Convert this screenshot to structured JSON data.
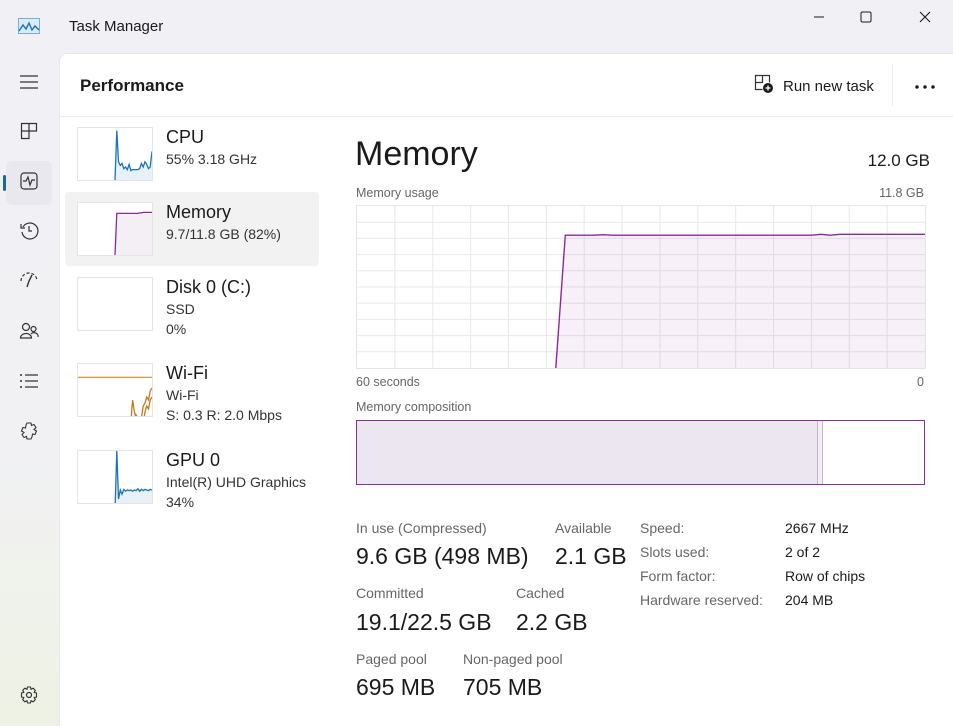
{
  "window": {
    "title": "Task Manager",
    "app_icon": "task-manager-icon",
    "controls": {
      "minimize": "minimize-icon",
      "maximize": "maximize-icon",
      "close": "close-icon"
    }
  },
  "nav": {
    "items": [
      {
        "icon": "hamburger-menu-icon",
        "label": "Menu",
        "active": false
      },
      {
        "icon": "processes-icon",
        "label": "Processes",
        "active": false
      },
      {
        "icon": "performance-icon",
        "label": "Performance",
        "active": true
      },
      {
        "icon": "app-history-icon",
        "label": "App history",
        "active": false
      },
      {
        "icon": "startup-apps-icon",
        "label": "Startup apps",
        "active": false
      },
      {
        "icon": "users-icon",
        "label": "Users",
        "active": false
      },
      {
        "icon": "details-icon",
        "label": "Details",
        "active": false
      },
      {
        "icon": "services-icon",
        "label": "Services",
        "active": false
      }
    ],
    "settings": {
      "icon": "settings-icon",
      "label": "Settings"
    }
  },
  "header": {
    "title": "Performance",
    "run_new_task": "Run new task",
    "more": "more-options-icon"
  },
  "colors": {
    "cpu": "#1a73b5",
    "memory": "#8b2a9a",
    "wifi": "#c27a1c",
    "gpu": "#1a73b5",
    "accent": "#1f6a8a"
  },
  "resources": [
    {
      "name": "CPU",
      "sub1": "55%  3.18 GHz",
      "sub2": "",
      "active": false
    },
    {
      "name": "Memory",
      "sub1": "9.7/11.8 GB (82%)",
      "sub2": "",
      "active": true
    },
    {
      "name": "Disk 0 (C:)",
      "sub1": "SSD",
      "sub2": "0%",
      "active": false
    },
    {
      "name": "Wi-Fi",
      "sub1": "Wi-Fi",
      "sub2": "S: 0.3 R: 2.0 Mbps",
      "active": false
    },
    {
      "name": "GPU 0",
      "sub1": "Intel(R) UHD Graphics",
      "sub2": "34%",
      "active": false
    }
  ],
  "memory": {
    "title": "Memory",
    "total": "12.0 GB",
    "usage_label": "Memory usage",
    "usage_max": "11.8 GB",
    "axis_left": "60 seconds",
    "axis_right": "0",
    "usage_series_fraction": [
      0,
      0,
      0,
      0,
      0,
      0,
      0,
      0,
      0,
      0,
      0,
      0,
      0,
      0,
      0,
      0,
      0,
      0,
      0,
      0,
      0,
      0,
      0.82,
      0.82,
      0.82,
      0.82,
      0.823,
      0.82,
      0.82,
      0.82,
      0.82,
      0.82,
      0.82,
      0.82,
      0.82,
      0.82,
      0.82,
      0.82,
      0.82,
      0.82,
      0.82,
      0.82,
      0.82,
      0.82,
      0.82,
      0.82,
      0.82,
      0.82,
      0.82,
      0.825,
      0.82,
      0.825,
      0.825,
      0.825,
      0.825,
      0.825,
      0.825,
      0.825,
      0.825,
      0.825,
      0.825
    ],
    "composition_label": "Memory composition",
    "composition": {
      "in_use_fraction": 0.815,
      "modified_fraction": 0.008
    },
    "stats": {
      "in_use_label": "In use (Compressed)",
      "in_use_value": "9.6 GB (498 MB)",
      "available_label": "Available",
      "available_value": "2.1 GB",
      "committed_label": "Committed",
      "committed_value": "19.1/22.5 GB",
      "cached_label": "Cached",
      "cached_value": "2.2 GB",
      "paged_label": "Paged pool",
      "paged_value": "695 MB",
      "nonpaged_label": "Non-paged pool",
      "nonpaged_value": "705 MB"
    },
    "specs": [
      {
        "label": "Speed:",
        "value": "2667 MHz"
      },
      {
        "label": "Slots used:",
        "value": "2 of 2"
      },
      {
        "label": "Form factor:",
        "value": "Row of chips"
      },
      {
        "label": "Hardware reserved:",
        "value": "204 MB"
      }
    ]
  },
  "sparklines": {
    "cpu": [
      0,
      0,
      0,
      0,
      0,
      0,
      0,
      0,
      0,
      0,
      0,
      0,
      0,
      0,
      0,
      0,
      0,
      0,
      0,
      0,
      0,
      0,
      0.95,
      0.35,
      0.28,
      0.32,
      0.22,
      0.25,
      0.2,
      0.3,
      0.18,
      0.2,
      0.2,
      0.2,
      0.2,
      0.22,
      0.32,
      0.25,
      0.35,
      0.3,
      0.22,
      0.25,
      0.55
    ],
    "memory": [
      0,
      0,
      0,
      0,
      0,
      0,
      0,
      0,
      0,
      0,
      0,
      0,
      0,
      0,
      0,
      0,
      0,
      0,
      0,
      0,
      0,
      0,
      0.8,
      0.8,
      0.8,
      0.8,
      0.8,
      0.8,
      0.8,
      0.8,
      0.8,
      0.8,
      0.8,
      0.8,
      0.8,
      0.81,
      0.81,
      0.82,
      0.82,
      0.82,
      0.82,
      0.82,
      0.82
    ],
    "disk": [
      0,
      0,
      0,
      0,
      0,
      0,
      0,
      0,
      0,
      0,
      0,
      0,
      0,
      0,
      0,
      0,
      0,
      0,
      0,
      0,
      0,
      0,
      0,
      0,
      0,
      0,
      0,
      0,
      0,
      0.02,
      0,
      0,
      0,
      0,
      0,
      0.03,
      0.06,
      0.02,
      0,
      0,
      0,
      0,
      0
    ],
    "wifi_send": [
      0,
      0,
      0,
      0,
      0,
      0,
      0,
      0,
      0,
      0,
      0,
      0,
      0,
      0,
      0,
      0,
      0,
      0,
      0,
      0,
      0,
      0,
      0.02,
      0.02,
      0.02,
      0.02,
      0.02,
      0.02,
      0.03,
      0.02,
      0.05,
      0.4,
      0.2,
      0.1,
      0.08,
      0.05,
      0.1,
      0.3,
      0.35,
      0.45,
      0.4,
      0.55,
      0.6
    ],
    "wifi_recv": [
      0,
      0,
      0,
      0,
      0,
      0,
      0,
      0,
      0,
      0,
      0,
      0,
      0,
      0,
      0,
      0,
      0,
      0,
      0,
      0,
      0,
      0,
      0.01,
      0.01,
      0.01,
      0.01,
      0.01,
      0.01,
      0.01,
      0.01,
      0.02,
      0.1,
      0.05,
      0.15,
      0.1,
      0.08,
      0.05,
      0.02,
      0.2,
      0.3,
      0.25,
      0.4,
      0.45
    ],
    "wifi_max_line": 0.78,
    "gpu": [
      0,
      0,
      0,
      0,
      0,
      0,
      0,
      0,
      0,
      0,
      0,
      0,
      0,
      0,
      0,
      0,
      0,
      0,
      0,
      0,
      0,
      0,
      1.0,
      0.2,
      0.35,
      0.28,
      0.36,
      0.33,
      0.35,
      0.34,
      0.35,
      0.33,
      0.35,
      0.34,
      0.37,
      0.33,
      0.36,
      0.34,
      0.36,
      0.35,
      0.34,
      0.36,
      0.35
    ]
  }
}
